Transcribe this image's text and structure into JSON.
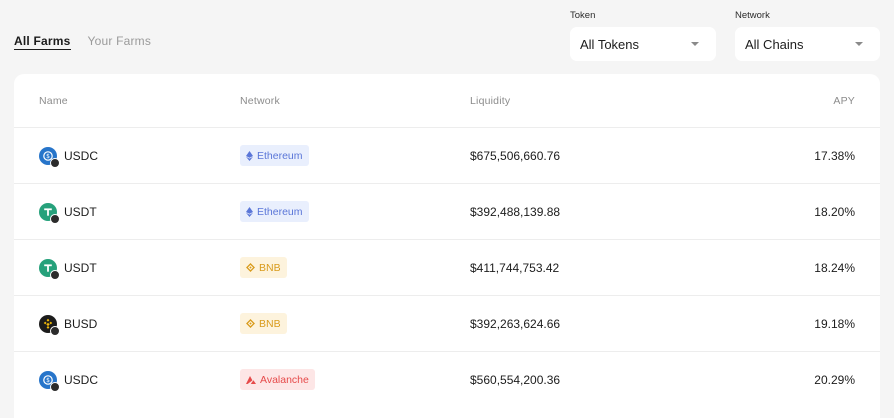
{
  "tabs": {
    "all_farms": "All Farms",
    "your_farms": "Your Farms"
  },
  "filters": {
    "token": {
      "label": "Token",
      "value": "All Tokens"
    },
    "network": {
      "label": "Network",
      "value": "All Chains"
    }
  },
  "table": {
    "headers": {
      "name": "Name",
      "network": "Network",
      "liquidity": "Liquidity",
      "apy": "APY"
    },
    "rows": [
      {
        "token": "USDC",
        "network": "Ethereum",
        "liquidity": "$675,506,660.76",
        "apy": "17.38%"
      },
      {
        "token": "USDT",
        "network": "Ethereum",
        "liquidity": "$392,488,139.88",
        "apy": "18.20%"
      },
      {
        "token": "USDT",
        "network": "BNB",
        "liquidity": "$411,744,753.42",
        "apy": "18.24%"
      },
      {
        "token": "BUSD",
        "network": "BNB",
        "liquidity": "$392,263,624.66",
        "apy": "19.18%"
      },
      {
        "token": "USDC",
        "network": "Avalanche",
        "liquidity": "$560,554,200.36",
        "apy": "20.29%"
      }
    ]
  },
  "icons": {
    "usdc": "usdc-coin-icon",
    "usdt": "usdt-coin-icon",
    "busd": "busd-coin-icon",
    "ethereum": "ethereum-icon",
    "bnb": "bnb-icon",
    "avalanche": "avalanche-icon",
    "caret": "chevron-down-icon"
  },
  "colors": {
    "page_bg": "#f5f5f5",
    "usdc": "#2775ca",
    "usdt": "#26a17b",
    "busd": "#1c1c1c",
    "ethereum_chip_bg": "#e9effd",
    "ethereum_text": "#5a76d8",
    "bnb_chip_bg": "#fdf3dd",
    "bnb_text": "#d99b1c",
    "avalanche_chip_bg": "#fde6e6",
    "avalanche_text": "#e64a4a"
  }
}
